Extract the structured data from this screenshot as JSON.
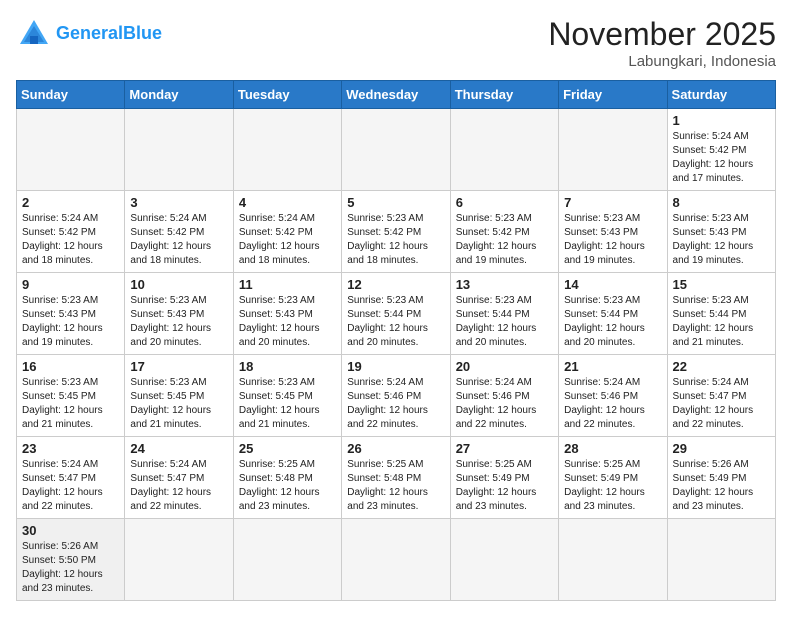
{
  "header": {
    "logo_general": "General",
    "logo_blue": "Blue",
    "month_year": "November 2025",
    "location": "Labungkari, Indonesia"
  },
  "weekdays": [
    "Sunday",
    "Monday",
    "Tuesday",
    "Wednesday",
    "Thursday",
    "Friday",
    "Saturday"
  ],
  "weeks": [
    [
      {
        "day": "",
        "info": ""
      },
      {
        "day": "",
        "info": ""
      },
      {
        "day": "",
        "info": ""
      },
      {
        "day": "",
        "info": ""
      },
      {
        "day": "",
        "info": ""
      },
      {
        "day": "",
        "info": ""
      },
      {
        "day": "1",
        "info": "Sunrise: 5:24 AM\nSunset: 5:42 PM\nDaylight: 12 hours\nand 17 minutes."
      }
    ],
    [
      {
        "day": "2",
        "info": "Sunrise: 5:24 AM\nSunset: 5:42 PM\nDaylight: 12 hours\nand 18 minutes."
      },
      {
        "day": "3",
        "info": "Sunrise: 5:24 AM\nSunset: 5:42 PM\nDaylight: 12 hours\nand 18 minutes."
      },
      {
        "day": "4",
        "info": "Sunrise: 5:24 AM\nSunset: 5:42 PM\nDaylight: 12 hours\nand 18 minutes."
      },
      {
        "day": "5",
        "info": "Sunrise: 5:23 AM\nSunset: 5:42 PM\nDaylight: 12 hours\nand 18 minutes."
      },
      {
        "day": "6",
        "info": "Sunrise: 5:23 AM\nSunset: 5:42 PM\nDaylight: 12 hours\nand 19 minutes."
      },
      {
        "day": "7",
        "info": "Sunrise: 5:23 AM\nSunset: 5:43 PM\nDaylight: 12 hours\nand 19 minutes."
      },
      {
        "day": "8",
        "info": "Sunrise: 5:23 AM\nSunset: 5:43 PM\nDaylight: 12 hours\nand 19 minutes."
      }
    ],
    [
      {
        "day": "9",
        "info": "Sunrise: 5:23 AM\nSunset: 5:43 PM\nDaylight: 12 hours\nand 19 minutes."
      },
      {
        "day": "10",
        "info": "Sunrise: 5:23 AM\nSunset: 5:43 PM\nDaylight: 12 hours\nand 20 minutes."
      },
      {
        "day": "11",
        "info": "Sunrise: 5:23 AM\nSunset: 5:43 PM\nDaylight: 12 hours\nand 20 minutes."
      },
      {
        "day": "12",
        "info": "Sunrise: 5:23 AM\nSunset: 5:44 PM\nDaylight: 12 hours\nand 20 minutes."
      },
      {
        "day": "13",
        "info": "Sunrise: 5:23 AM\nSunset: 5:44 PM\nDaylight: 12 hours\nand 20 minutes."
      },
      {
        "day": "14",
        "info": "Sunrise: 5:23 AM\nSunset: 5:44 PM\nDaylight: 12 hours\nand 20 minutes."
      },
      {
        "day": "15",
        "info": "Sunrise: 5:23 AM\nSunset: 5:44 PM\nDaylight: 12 hours\nand 21 minutes."
      }
    ],
    [
      {
        "day": "16",
        "info": "Sunrise: 5:23 AM\nSunset: 5:45 PM\nDaylight: 12 hours\nand 21 minutes."
      },
      {
        "day": "17",
        "info": "Sunrise: 5:23 AM\nSunset: 5:45 PM\nDaylight: 12 hours\nand 21 minutes."
      },
      {
        "day": "18",
        "info": "Sunrise: 5:23 AM\nSunset: 5:45 PM\nDaylight: 12 hours\nand 21 minutes."
      },
      {
        "day": "19",
        "info": "Sunrise: 5:24 AM\nSunset: 5:46 PM\nDaylight: 12 hours\nand 22 minutes."
      },
      {
        "day": "20",
        "info": "Sunrise: 5:24 AM\nSunset: 5:46 PM\nDaylight: 12 hours\nand 22 minutes."
      },
      {
        "day": "21",
        "info": "Sunrise: 5:24 AM\nSunset: 5:46 PM\nDaylight: 12 hours\nand 22 minutes."
      },
      {
        "day": "22",
        "info": "Sunrise: 5:24 AM\nSunset: 5:47 PM\nDaylight: 12 hours\nand 22 minutes."
      }
    ],
    [
      {
        "day": "23",
        "info": "Sunrise: 5:24 AM\nSunset: 5:47 PM\nDaylight: 12 hours\nand 22 minutes."
      },
      {
        "day": "24",
        "info": "Sunrise: 5:24 AM\nSunset: 5:47 PM\nDaylight: 12 hours\nand 22 minutes."
      },
      {
        "day": "25",
        "info": "Sunrise: 5:25 AM\nSunset: 5:48 PM\nDaylight: 12 hours\nand 23 minutes."
      },
      {
        "day": "26",
        "info": "Sunrise: 5:25 AM\nSunset: 5:48 PM\nDaylight: 12 hours\nand 23 minutes."
      },
      {
        "day": "27",
        "info": "Sunrise: 5:25 AM\nSunset: 5:49 PM\nDaylight: 12 hours\nand 23 minutes."
      },
      {
        "day": "28",
        "info": "Sunrise: 5:25 AM\nSunset: 5:49 PM\nDaylight: 12 hours\nand 23 minutes."
      },
      {
        "day": "29",
        "info": "Sunrise: 5:26 AM\nSunset: 5:49 PM\nDaylight: 12 hours\nand 23 minutes."
      }
    ],
    [
      {
        "day": "30",
        "info": "Sunrise: 5:26 AM\nSunset: 5:50 PM\nDaylight: 12 hours\nand 23 minutes."
      },
      {
        "day": "",
        "info": ""
      },
      {
        "day": "",
        "info": ""
      },
      {
        "day": "",
        "info": ""
      },
      {
        "day": "",
        "info": ""
      },
      {
        "day": "",
        "info": ""
      },
      {
        "day": "",
        "info": ""
      }
    ]
  ]
}
